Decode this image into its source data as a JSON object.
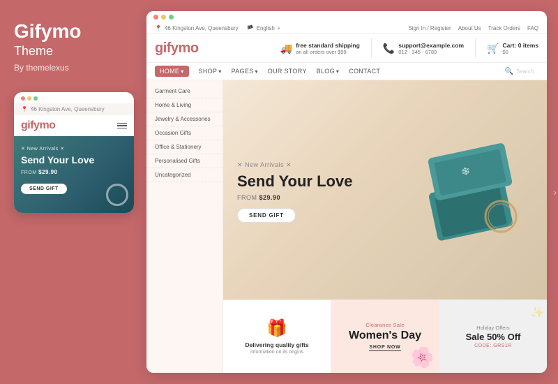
{
  "left": {
    "brand": "Gifymo",
    "theme_label": "Theme",
    "by": "By themelexus"
  },
  "mobile": {
    "dots": [
      "red",
      "yellow",
      "green"
    ],
    "location": "46 Kingston Ave, Queensbury",
    "logo": "gifymo",
    "new_arrivals": "✕ New Arrivals ✕",
    "hero_title": "Send Your Love",
    "from_label": "FROM",
    "price": "$29.90",
    "send_btn": "SEND GIFT"
  },
  "desktop": {
    "dots": [
      "red",
      "yellow",
      "green"
    ],
    "utility": {
      "location": "46 Kingston Ave, Queensbury",
      "language": "English",
      "sign_in": "Sign In / Register",
      "about": "About Us",
      "track": "Track Orders",
      "faq": "FAQ"
    },
    "header": {
      "logo": "gifymo",
      "shipping_main": "free standard shipping",
      "shipping_sub": "on all orders over $99",
      "phone_main": "support@example.com",
      "phone_sub": "012 - 345 - 6789",
      "cart_label": "Cart:",
      "cart_items": "0 items",
      "cart_amount": "$0"
    },
    "nav": {
      "items": [
        "HOME",
        "SHOP",
        "PAGES",
        "OUR STORY",
        "BLOG",
        "CONTACT"
      ],
      "active": "HOME",
      "search_placeholder": "Search..."
    },
    "dropdown": {
      "items": [
        "Garment Care",
        "Home & Living",
        "Jewelry & Accessories",
        "Occasion Gifts",
        "Office & Stationery",
        "Personalised Gifts",
        "Uncategorized"
      ]
    },
    "hero": {
      "new_arrivals": "✕ New Arrivals ✕",
      "title_line1": "Send Your Love",
      "from_label": "FROM",
      "price": "$29.90",
      "send_btn": "SEND GIFT"
    },
    "promo": [
      {
        "type": "delivery",
        "icon": "🎁",
        "title": "Delivering quality gifts",
        "subtitle": "information on its origins"
      },
      {
        "type": "womens-day",
        "sale_label": "Clearance Sale",
        "title": "Women's Day",
        "cta": "SHOP NOW"
      },
      {
        "type": "holiday",
        "tag": "Holiday Offers",
        "title_line1": "Sale 50% Off",
        "code": "CODE: GRS1R"
      }
    ]
  }
}
